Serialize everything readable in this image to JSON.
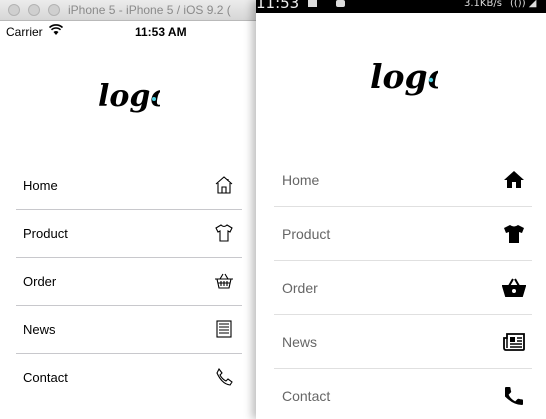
{
  "ios": {
    "window_title": "iPhone 5 - iPhone 5 / iOS 9.2 (",
    "carrier": "Carrier",
    "time": "11:53 AM",
    "logo_text": "logo",
    "menu": [
      {
        "label": "Home",
        "icon": "home-icon"
      },
      {
        "label": "Product",
        "icon": "tshirt-icon"
      },
      {
        "label": "Order",
        "icon": "basket-icon"
      },
      {
        "label": "News",
        "icon": "newspaper-icon"
      },
      {
        "label": "Contact",
        "icon": "phone-icon"
      }
    ]
  },
  "android": {
    "status": {
      "time": "11:53",
      "speed": "3.1KB/s",
      "signal_text": "(()) ◢"
    },
    "logo_text": "logo",
    "menu": [
      {
        "label": "Home",
        "icon": "home-icon"
      },
      {
        "label": "Product",
        "icon": "tshirt-icon"
      },
      {
        "label": "Order",
        "icon": "basket-icon"
      },
      {
        "label": "News",
        "icon": "newspaper-icon"
      },
      {
        "label": "Contact",
        "icon": "phone-icon"
      }
    ]
  },
  "colors": {
    "logo_dot": "#4dd0e1",
    "divider_ios": "#c8c8cc",
    "divider_android": "#e0e0e0",
    "android_label": "#666666"
  }
}
